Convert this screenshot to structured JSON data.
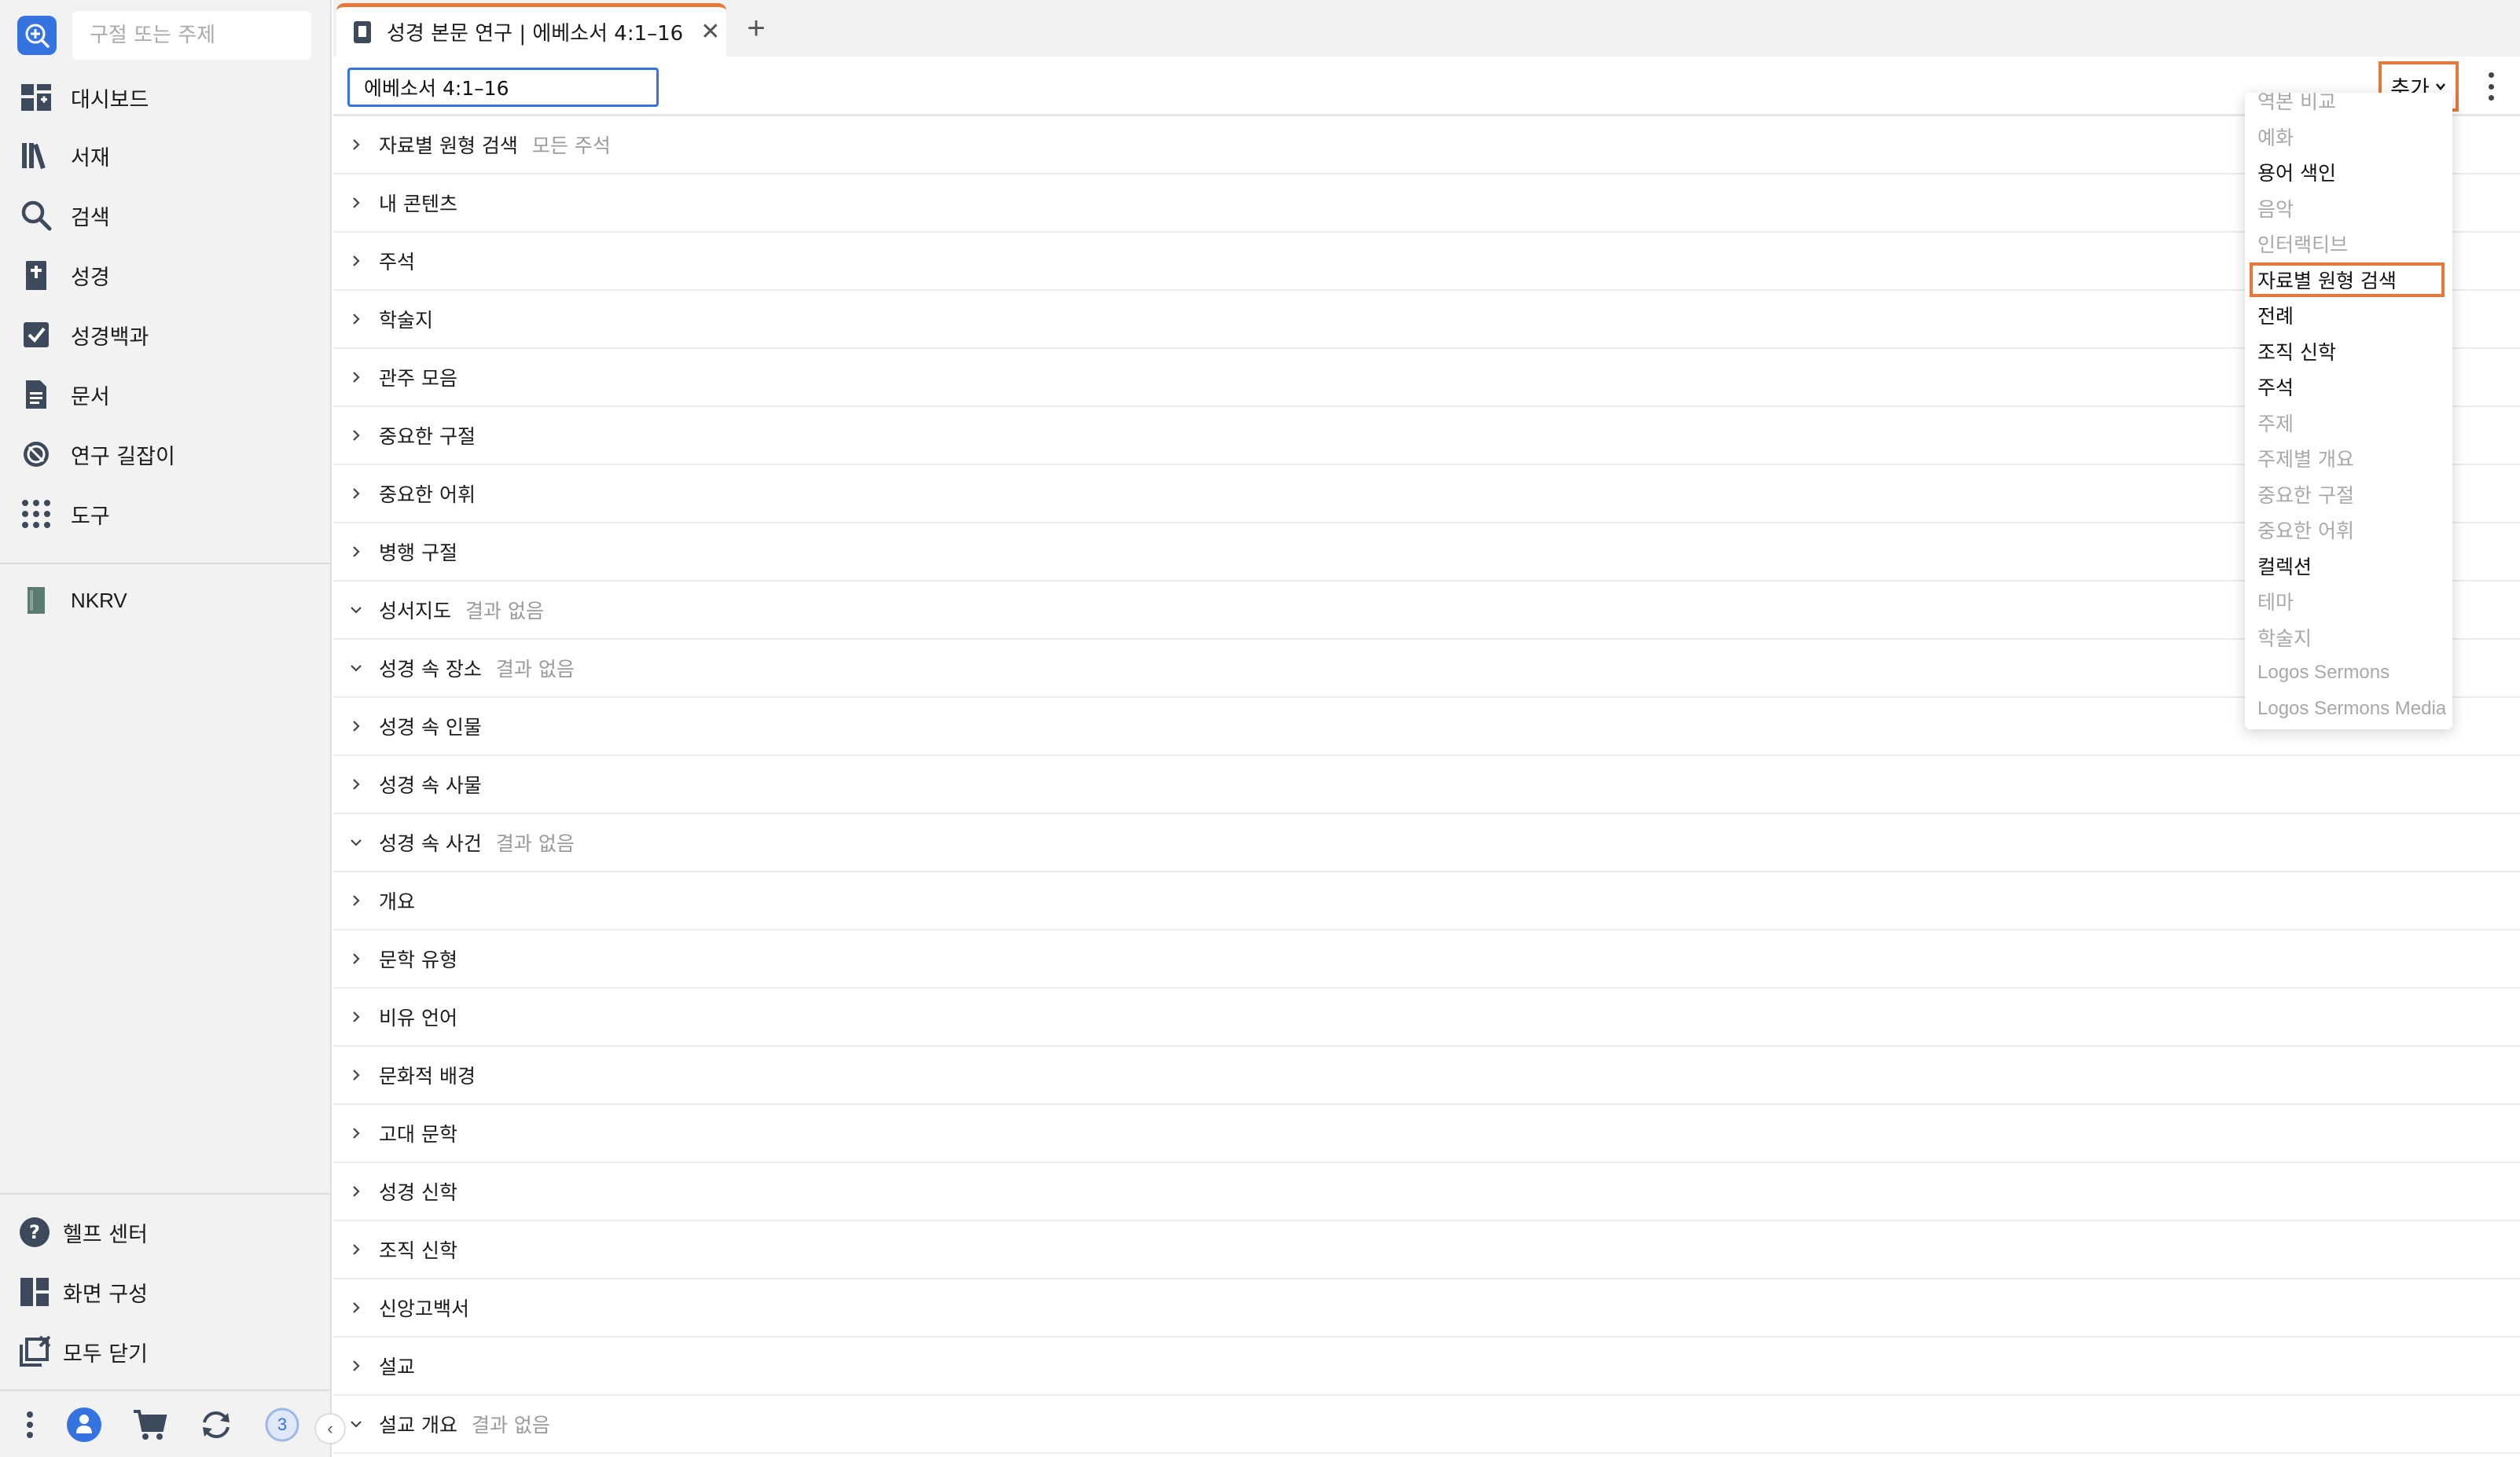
{
  "sidebar": {
    "search_placeholder": "구절 또는 주제",
    "items": [
      {
        "label": "대시보드",
        "icon": "dashboard-icon"
      },
      {
        "label": "서재",
        "icon": "library-icon"
      },
      {
        "label": "검색",
        "icon": "search-icon"
      },
      {
        "label": "성경",
        "icon": "bible-icon"
      },
      {
        "label": "성경백과",
        "icon": "factbook-icon"
      },
      {
        "label": "문서",
        "icon": "document-icon"
      },
      {
        "label": "연구 길잡이",
        "icon": "guides-icon"
      },
      {
        "label": "도구",
        "icon": "tools-icon"
      }
    ],
    "pinned": [
      {
        "label": "NKRV",
        "icon": "book-icon"
      }
    ],
    "bottom_items": [
      {
        "label": "헬프 센터",
        "icon": "help-icon"
      },
      {
        "label": "화면 구성",
        "icon": "layouts-icon"
      },
      {
        "label": "모두 닫기",
        "icon": "close-all-icon"
      }
    ],
    "notification_count": "3"
  },
  "tab": {
    "title": "성경 본문 연구 | 에베소서 4:1–16",
    "close": "✕",
    "add": "+"
  },
  "toolbar": {
    "reference_value": "에베소서 4:1–16",
    "add_label": "추가"
  },
  "sections": [
    {
      "label": "자료별 원형 검색",
      "note": "모든 주석",
      "expanded": false
    },
    {
      "label": "내 콘텐츠",
      "note": "",
      "expanded": false
    },
    {
      "label": "주석",
      "note": "",
      "expanded": false
    },
    {
      "label": "학술지",
      "note": "",
      "expanded": false
    },
    {
      "label": "관주 모음",
      "note": "",
      "expanded": false
    },
    {
      "label": "중요한 구절",
      "note": "",
      "expanded": false
    },
    {
      "label": "중요한 어휘",
      "note": "",
      "expanded": false
    },
    {
      "label": "병행 구절",
      "note": "",
      "expanded": false
    },
    {
      "label": "성서지도",
      "note": "결과 없음",
      "expanded": true
    },
    {
      "label": "성경 속 장소",
      "note": "결과 없음",
      "expanded": true
    },
    {
      "label": "성경 속 인물",
      "note": "",
      "expanded": false
    },
    {
      "label": "성경 속 사물",
      "note": "",
      "expanded": false
    },
    {
      "label": "성경 속 사건",
      "note": "결과 없음",
      "expanded": true
    },
    {
      "label": "개요",
      "note": "",
      "expanded": false
    },
    {
      "label": "문학 유형",
      "note": "",
      "expanded": false
    },
    {
      "label": "비유 언어",
      "note": "",
      "expanded": false
    },
    {
      "label": "문화적 배경",
      "note": "",
      "expanded": false
    },
    {
      "label": "고대 문학",
      "note": "",
      "expanded": false
    },
    {
      "label": "성경 신학",
      "note": "",
      "expanded": false
    },
    {
      "label": "조직 신학",
      "note": "",
      "expanded": false
    },
    {
      "label": "신앙고백서",
      "note": "",
      "expanded": false
    },
    {
      "label": "설교",
      "note": "",
      "expanded": false
    },
    {
      "label": "설교 개요",
      "note": "결과 없음",
      "expanded": true
    }
  ],
  "dropdown": {
    "items": [
      {
        "label": "역본 비교",
        "enabled": false
      },
      {
        "label": "예화",
        "enabled": false
      },
      {
        "label": "용어 색인",
        "enabled": true
      },
      {
        "label": "음악",
        "enabled": false
      },
      {
        "label": "인터랙티브",
        "enabled": false
      },
      {
        "label": "자료별 원형 검색",
        "enabled": true,
        "highlight": true
      },
      {
        "label": "전례",
        "enabled": true
      },
      {
        "label": "조직 신학",
        "enabled": true
      },
      {
        "label": "주석",
        "enabled": true
      },
      {
        "label": "주제",
        "enabled": false
      },
      {
        "label": "주제별 개요",
        "enabled": false
      },
      {
        "label": "중요한 구절",
        "enabled": false
      },
      {
        "label": "중요한 어휘",
        "enabled": false
      },
      {
        "label": "컬렉션",
        "enabled": true
      },
      {
        "label": "테마",
        "enabled": false
      },
      {
        "label": "학술지",
        "enabled": false
      },
      {
        "label": "Logos Sermons",
        "enabled": false
      },
      {
        "label": "Logos Sermons Media",
        "enabled": false
      }
    ]
  },
  "colors": {
    "accent": "#e8773a",
    "brand": "#3574e0",
    "muted": "#9a9a9a"
  }
}
